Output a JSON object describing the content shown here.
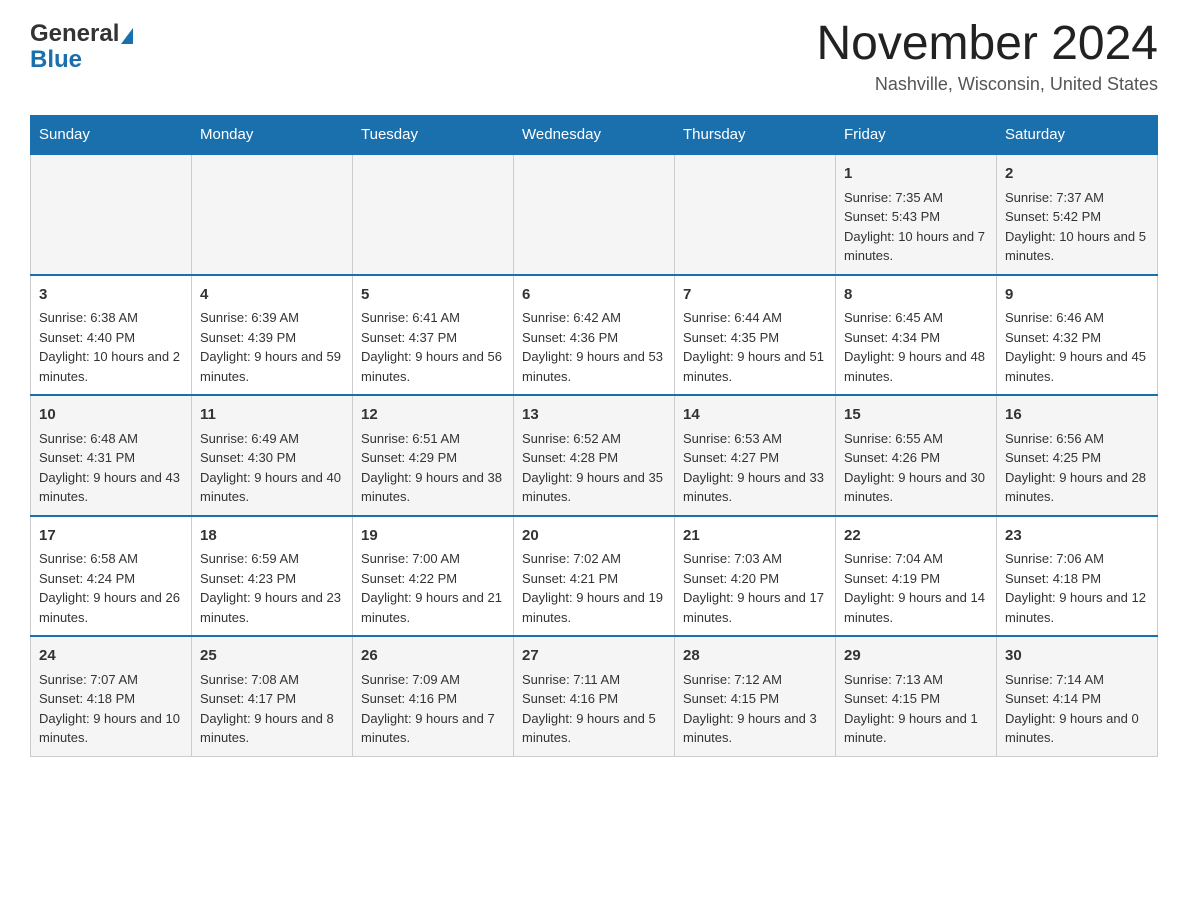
{
  "header": {
    "logo_general": "General",
    "logo_blue": "Blue",
    "month_title": "November 2024",
    "location": "Nashville, Wisconsin, United States"
  },
  "days_of_week": [
    "Sunday",
    "Monday",
    "Tuesday",
    "Wednesday",
    "Thursday",
    "Friday",
    "Saturday"
  ],
  "weeks": [
    {
      "cells": [
        {
          "day": "",
          "info": ""
        },
        {
          "day": "",
          "info": ""
        },
        {
          "day": "",
          "info": ""
        },
        {
          "day": "",
          "info": ""
        },
        {
          "day": "",
          "info": ""
        },
        {
          "day": "1",
          "info": "Sunrise: 7:35 AM\nSunset: 5:43 PM\nDaylight: 10 hours and 7 minutes."
        },
        {
          "day": "2",
          "info": "Sunrise: 7:37 AM\nSunset: 5:42 PM\nDaylight: 10 hours and 5 minutes."
        }
      ]
    },
    {
      "cells": [
        {
          "day": "3",
          "info": "Sunrise: 6:38 AM\nSunset: 4:40 PM\nDaylight: 10 hours and 2 minutes."
        },
        {
          "day": "4",
          "info": "Sunrise: 6:39 AM\nSunset: 4:39 PM\nDaylight: 9 hours and 59 minutes."
        },
        {
          "day": "5",
          "info": "Sunrise: 6:41 AM\nSunset: 4:37 PM\nDaylight: 9 hours and 56 minutes."
        },
        {
          "day": "6",
          "info": "Sunrise: 6:42 AM\nSunset: 4:36 PM\nDaylight: 9 hours and 53 minutes."
        },
        {
          "day": "7",
          "info": "Sunrise: 6:44 AM\nSunset: 4:35 PM\nDaylight: 9 hours and 51 minutes."
        },
        {
          "day": "8",
          "info": "Sunrise: 6:45 AM\nSunset: 4:34 PM\nDaylight: 9 hours and 48 minutes."
        },
        {
          "day": "9",
          "info": "Sunrise: 6:46 AM\nSunset: 4:32 PM\nDaylight: 9 hours and 45 minutes."
        }
      ]
    },
    {
      "cells": [
        {
          "day": "10",
          "info": "Sunrise: 6:48 AM\nSunset: 4:31 PM\nDaylight: 9 hours and 43 minutes."
        },
        {
          "day": "11",
          "info": "Sunrise: 6:49 AM\nSunset: 4:30 PM\nDaylight: 9 hours and 40 minutes."
        },
        {
          "day": "12",
          "info": "Sunrise: 6:51 AM\nSunset: 4:29 PM\nDaylight: 9 hours and 38 minutes."
        },
        {
          "day": "13",
          "info": "Sunrise: 6:52 AM\nSunset: 4:28 PM\nDaylight: 9 hours and 35 minutes."
        },
        {
          "day": "14",
          "info": "Sunrise: 6:53 AM\nSunset: 4:27 PM\nDaylight: 9 hours and 33 minutes."
        },
        {
          "day": "15",
          "info": "Sunrise: 6:55 AM\nSunset: 4:26 PM\nDaylight: 9 hours and 30 minutes."
        },
        {
          "day": "16",
          "info": "Sunrise: 6:56 AM\nSunset: 4:25 PM\nDaylight: 9 hours and 28 minutes."
        }
      ]
    },
    {
      "cells": [
        {
          "day": "17",
          "info": "Sunrise: 6:58 AM\nSunset: 4:24 PM\nDaylight: 9 hours and 26 minutes."
        },
        {
          "day": "18",
          "info": "Sunrise: 6:59 AM\nSunset: 4:23 PM\nDaylight: 9 hours and 23 minutes."
        },
        {
          "day": "19",
          "info": "Sunrise: 7:00 AM\nSunset: 4:22 PM\nDaylight: 9 hours and 21 minutes."
        },
        {
          "day": "20",
          "info": "Sunrise: 7:02 AM\nSunset: 4:21 PM\nDaylight: 9 hours and 19 minutes."
        },
        {
          "day": "21",
          "info": "Sunrise: 7:03 AM\nSunset: 4:20 PM\nDaylight: 9 hours and 17 minutes."
        },
        {
          "day": "22",
          "info": "Sunrise: 7:04 AM\nSunset: 4:19 PM\nDaylight: 9 hours and 14 minutes."
        },
        {
          "day": "23",
          "info": "Sunrise: 7:06 AM\nSunset: 4:18 PM\nDaylight: 9 hours and 12 minutes."
        }
      ]
    },
    {
      "cells": [
        {
          "day": "24",
          "info": "Sunrise: 7:07 AM\nSunset: 4:18 PM\nDaylight: 9 hours and 10 minutes."
        },
        {
          "day": "25",
          "info": "Sunrise: 7:08 AM\nSunset: 4:17 PM\nDaylight: 9 hours and 8 minutes."
        },
        {
          "day": "26",
          "info": "Sunrise: 7:09 AM\nSunset: 4:16 PM\nDaylight: 9 hours and 7 minutes."
        },
        {
          "day": "27",
          "info": "Sunrise: 7:11 AM\nSunset: 4:16 PM\nDaylight: 9 hours and 5 minutes."
        },
        {
          "day": "28",
          "info": "Sunrise: 7:12 AM\nSunset: 4:15 PM\nDaylight: 9 hours and 3 minutes."
        },
        {
          "day": "29",
          "info": "Sunrise: 7:13 AM\nSunset: 4:15 PM\nDaylight: 9 hours and 1 minute."
        },
        {
          "day": "30",
          "info": "Sunrise: 7:14 AM\nSunset: 4:14 PM\nDaylight: 9 hours and 0 minutes."
        }
      ]
    }
  ]
}
